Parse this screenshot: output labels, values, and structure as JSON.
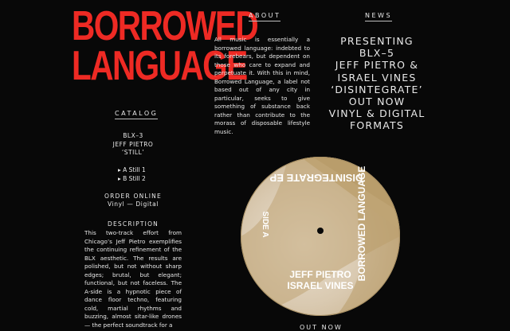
{
  "logo": {
    "line1": "BORROWED",
    "line2": "LANGUAGE"
  },
  "about": {
    "heading": "ABOUT",
    "text": "All music is essentially a borrowed language: indebted to its forebears, but dependent on those who care to expand and perpetuate it. With this in mind, Borrowed Language, a label not based out of any city in particular, seeks to give something of substance back rather than contribute to the morass of disposable lifestyle music."
  },
  "news": {
    "heading": "NEWS",
    "lines": [
      "PRESENTING",
      "BLX–5",
      "JEFF PIETRO &",
      "ISRAEL VINES",
      "‘DISINTEGRATE’",
      "OUT NOW",
      "VINYL & DIGITAL",
      "FORMATS"
    ]
  },
  "catalog": {
    "heading": "CATALOG",
    "code": "BLX–3",
    "artist": "JEFF PIETRO",
    "title": "‘STILL’",
    "tracks": [
      "A Still 1",
      "B Still 2"
    ],
    "order_label": "ORDER ONLINE",
    "formats": "Vinyl — Digital",
    "description_heading": "DESCRIPTION",
    "description": "This two-track effort from Chicago’s Jeff Pietro exemplifies the continuing refinement of the BLX aesthetic. The results are polished, but not without sharp edges; brutal, but elegant; functional, but not faceless. The A-side is a hypnotic piece of dance floor techno, featuring cold, martial rhythms and buzzing, almost sitar-like drones — the perfect soundtrack for a"
  },
  "record": {
    "title": "DISINTEGRATE EP",
    "label": "BORROWED LANGUAGE",
    "side": "SIDE A",
    "artist1": "JEFF PIETRO",
    "artist2": "ISRAEL VINES",
    "colors": {
      "gold": "#bfa474",
      "cream": "#e9ddcc"
    }
  },
  "footer_label": "OUT NOW"
}
